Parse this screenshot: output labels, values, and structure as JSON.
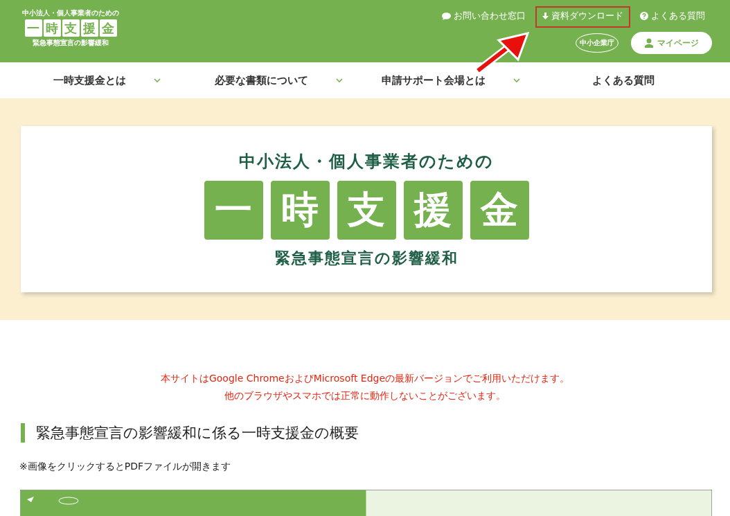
{
  "header": {
    "logo": {
      "top": "中小法人・個人事業者のための",
      "chars": [
        "一",
        "時",
        "支",
        "援",
        "金"
      ],
      "bottom": "緊急事態宣言の影響緩和"
    },
    "links": [
      {
        "label": "お問い合わせ窓口",
        "kind": "chat",
        "highlighted": false
      },
      {
        "label": "資料ダウンロード",
        "kind": "download",
        "highlighted": true
      },
      {
        "label": "よくある質問",
        "kind": "help",
        "highlighted": false
      }
    ],
    "agency_logo": "中小企業庁",
    "mypage_button": "マイページ"
  },
  "nav": [
    {
      "label": "一時支援金とは",
      "has_dropdown": true
    },
    {
      "label": "必要な書類について",
      "has_dropdown": true
    },
    {
      "label": "申請サポート会場とは",
      "has_dropdown": true
    },
    {
      "label": "よくある質問",
      "has_dropdown": false
    }
  ],
  "hero": {
    "top": "中小法人・個人事業者のための",
    "chars": [
      "一",
      "時",
      "支",
      "援",
      "金"
    ],
    "bottom": "緊急事態宣言の影響緩和"
  },
  "notice": [
    "本サイトはGoogle ChromeおよびMicrosoft Edgeの最新バージョンでご利用いただけます。",
    "他のブラウザやスマホでは正常に動作しないことがございます。"
  ],
  "section_title": "緊急事態宣言の影響緩和に係る一時支援金の概要",
  "note": "※画像をクリックするとPDFファイルが開きます",
  "document": {
    "kind": "picture"
  }
}
